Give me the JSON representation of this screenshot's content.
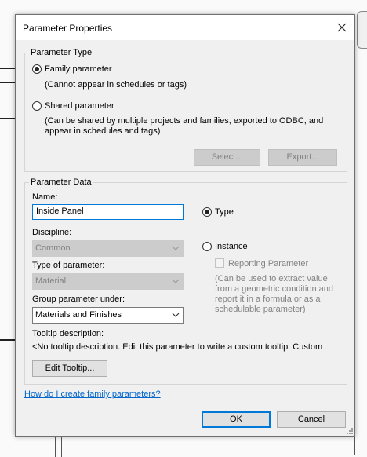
{
  "window": {
    "title": "Parameter Properties",
    "close_icon": "close-icon"
  },
  "parameter_type": {
    "legend": "Parameter Type",
    "family_label": "Family parameter",
    "family_note": "(Cannot appear in schedules or tags)",
    "shared_label": "Shared parameter",
    "shared_note_line1": "(Can be shared by multiple projects and families, exported to ODBC, and",
    "shared_note_line2": "appear in schedules and tags)",
    "select_label": "Select...",
    "export_label": "Export...",
    "selected": "family"
  },
  "parameter_data": {
    "legend": "Parameter Data",
    "name_label": "Name:",
    "name_value": "Inside Panel",
    "discipline_label": "Discipline:",
    "discipline_value": "Common",
    "type_of_param_label": "Type of parameter:",
    "type_of_param_value": "Material",
    "group_label": "Group parameter under:",
    "group_value": "Materials and Finishes",
    "type_radio_label": "Type",
    "instance_radio_label": "Instance",
    "reporting_label": "Reporting Parameter",
    "reporting_note_line1": "(Can be used to extract value",
    "reporting_note_line2": "from a geometric condition and",
    "reporting_note_line3": "report it in a formula or as a",
    "reporting_note_line4": "schedulable parameter)",
    "tooltip_label": "Tooltip description:",
    "tooltip_text": "<No tooltip description. Edit this parameter to write a custom tooltip. Custom",
    "edit_tooltip_label": "Edit Tooltip...",
    "selected": "type"
  },
  "footer": {
    "help_link": "How do I create family parameters?",
    "ok_label": "OK",
    "cancel_label": "Cancel"
  },
  "colors": {
    "accent": "#0078d7",
    "link": "#0066cc",
    "disabled_text": "#838383"
  }
}
